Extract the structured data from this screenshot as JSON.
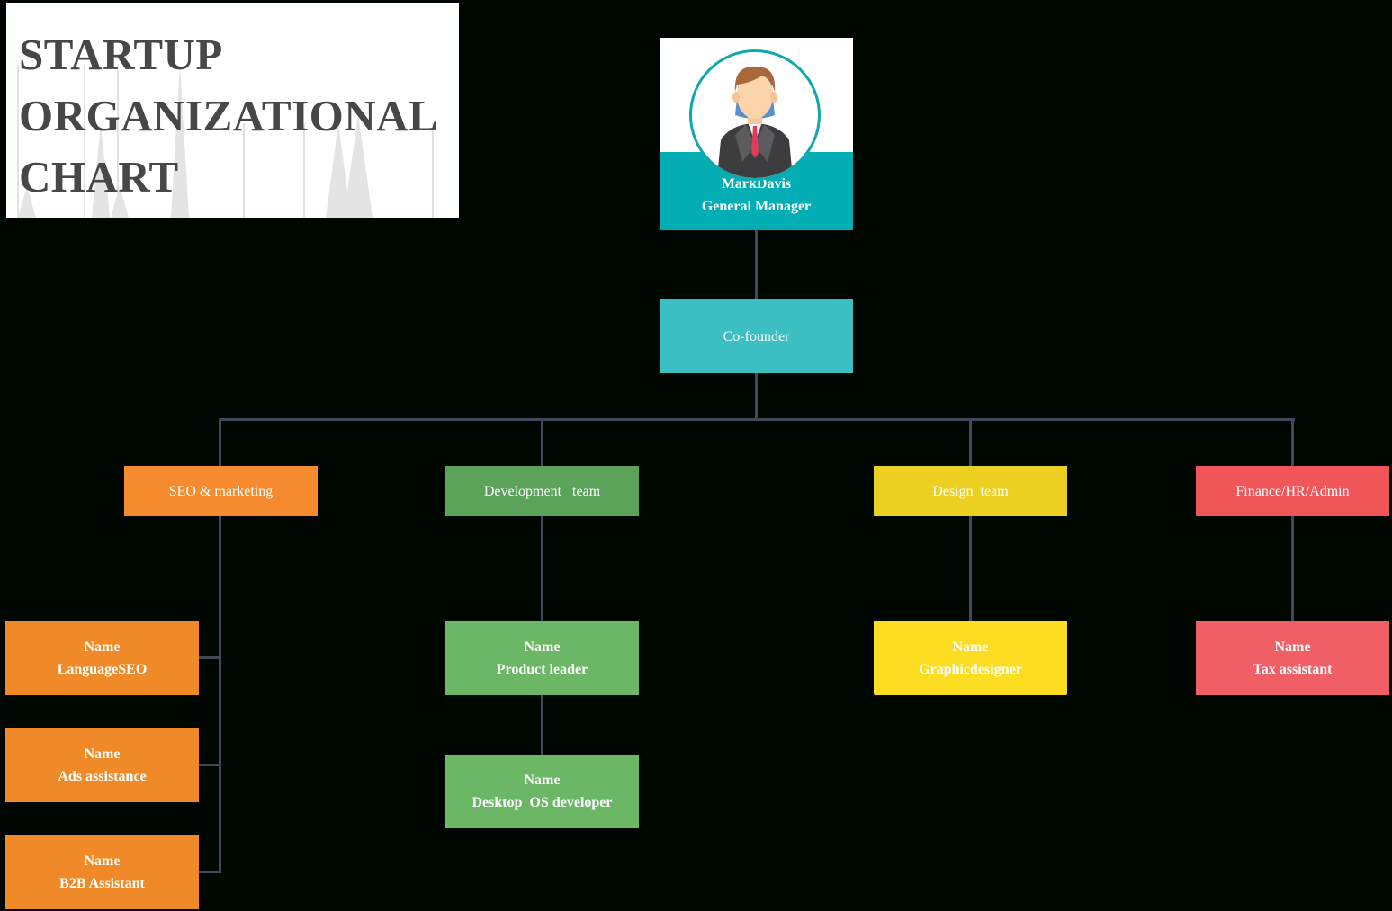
{
  "title": {
    "lines": [
      "STARTUP",
      "ORGANIZATIONAL",
      "CHART"
    ]
  },
  "colors": {
    "background": "#000600",
    "connector": "#3d4a5c",
    "gm": "#02adb4",
    "cofounder": "#3bbfc3",
    "seo": "#f68a2f",
    "seo_member": "#f08a28",
    "dev": "#5ca35a",
    "dev_member": "#6bb766",
    "design": "#ecd021",
    "design_member": "#fddd21",
    "finance": "#f05558",
    "finance_member": "#f15f66"
  },
  "general_manager": {
    "name": "MarkDavis",
    "role": "General Manager",
    "avatar_icon": "person-avatar-icon"
  },
  "cofounder": {
    "label": "Co-founder"
  },
  "departments": [
    {
      "label": "SEO & marketing",
      "members": [
        {
          "name": "Name",
          "role": "LanguageSEO"
        },
        {
          "name": "Name",
          "role": "Ads assistance"
        },
        {
          "name": "Name",
          "role": "B2B Assistant"
        }
      ]
    },
    {
      "label": "Development   team",
      "members": [
        {
          "name": "Name",
          "role": "Product leader"
        },
        {
          "name": "Name",
          "role": "Desktop  OS developer"
        }
      ]
    },
    {
      "label": "Design  team",
      "members": [
        {
          "name": "Name",
          "role": "Graphicdesigner"
        }
      ]
    },
    {
      "label": "Finance/HR/Admin",
      "members": [
        {
          "name": "Name",
          "role": "Tax assistant"
        }
      ]
    }
  ]
}
